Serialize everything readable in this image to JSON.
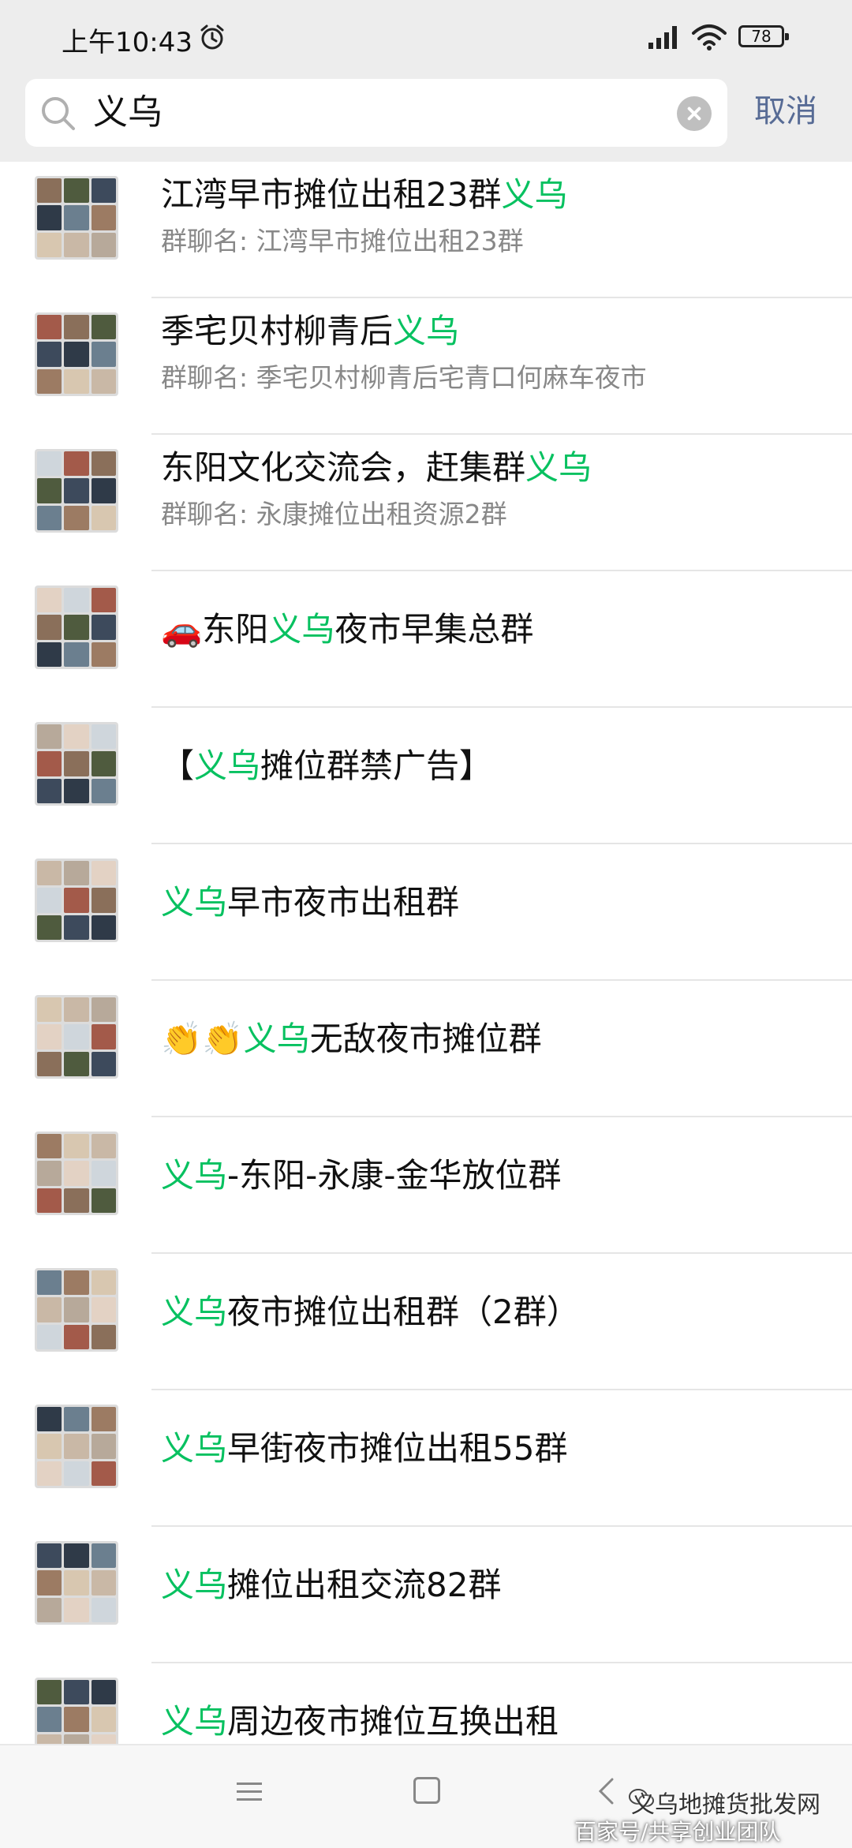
{
  "status_bar": {
    "time": "上午10:43",
    "battery": "78"
  },
  "search": {
    "query": "义乌",
    "cancel_label": "取消"
  },
  "results": [
    {
      "pre": "江湾早市摊位出租23群",
      "hl": "义乌",
      "post": "",
      "subtitle": "群聊名: 江湾早市摊位出租23群"
    },
    {
      "pre": "季宅贝村柳青后",
      "hl": "义乌",
      "post": "",
      "subtitle": "群聊名: 季宅贝村柳青后宅青口何麻车夜市"
    },
    {
      "pre": "东阳文化交流会，赶集群",
      "hl": "义乌",
      "post": "",
      "subtitle": "群聊名: 永康摊位出租资源2群"
    },
    {
      "pre": "🚗东阳",
      "hl": "义乌",
      "post": "夜市早集总群",
      "subtitle": ""
    },
    {
      "pre": "【",
      "hl": "义乌",
      "post": "摊位群禁广告】",
      "subtitle": ""
    },
    {
      "pre": "",
      "hl": "义乌",
      "post": "早市夜市出租群",
      "subtitle": ""
    },
    {
      "pre": "👏👏",
      "hl": "义乌",
      "post": "无敌夜市摊位群",
      "subtitle": ""
    },
    {
      "pre": "",
      "hl": "义乌",
      "post": "-东阳-永康-金华放位群",
      "subtitle": ""
    },
    {
      "pre": "",
      "hl": "义乌",
      "post": "夜市摊位出租群（2群）",
      "subtitle": ""
    },
    {
      "pre": "",
      "hl": "义乌",
      "post": "早街夜市摊位出租55群",
      "subtitle": ""
    },
    {
      "pre": "",
      "hl": "义乌",
      "post": "摊位出租交流82群",
      "subtitle": ""
    },
    {
      "pre": "",
      "hl": "义乌",
      "post": "周边夜市摊位互换出租",
      "subtitle": ""
    }
  ],
  "watermark": {
    "line1": "义乌地摊货批发网",
    "line2": "百家号/共享创业团队"
  },
  "colors": {
    "highlight": "#07c160",
    "cancel": "#576b95",
    "subtitle": "#888888"
  }
}
